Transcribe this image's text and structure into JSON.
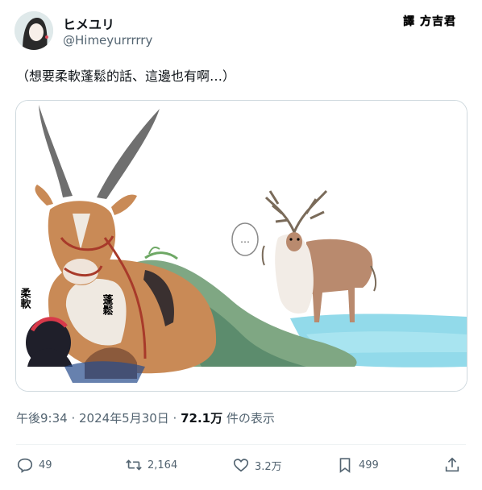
{
  "author": {
    "display_name": "ヒメユリ",
    "handle": "@Himeyurrrrry"
  },
  "watermark": "譯 方吉君",
  "tweet": {
    "text": "（想要柔軟蓬鬆的話、這邊也有啊…）"
  },
  "image_text": {
    "label_left": "柔軟",
    "label_right": "蓬鬆",
    "speech": "…"
  },
  "meta": {
    "time_date": "午後9:34 · 2024年5月30日 · ",
    "views_count": "72.1万",
    "views_suffix": " 件の表示"
  },
  "actions": {
    "replies": "49",
    "reposts": "2,164",
    "likes": "3.2万",
    "bookmarks": "499"
  },
  "icons": [
    "reply-icon",
    "repost-icon",
    "like-icon",
    "bookmark-icon",
    "share-icon"
  ]
}
